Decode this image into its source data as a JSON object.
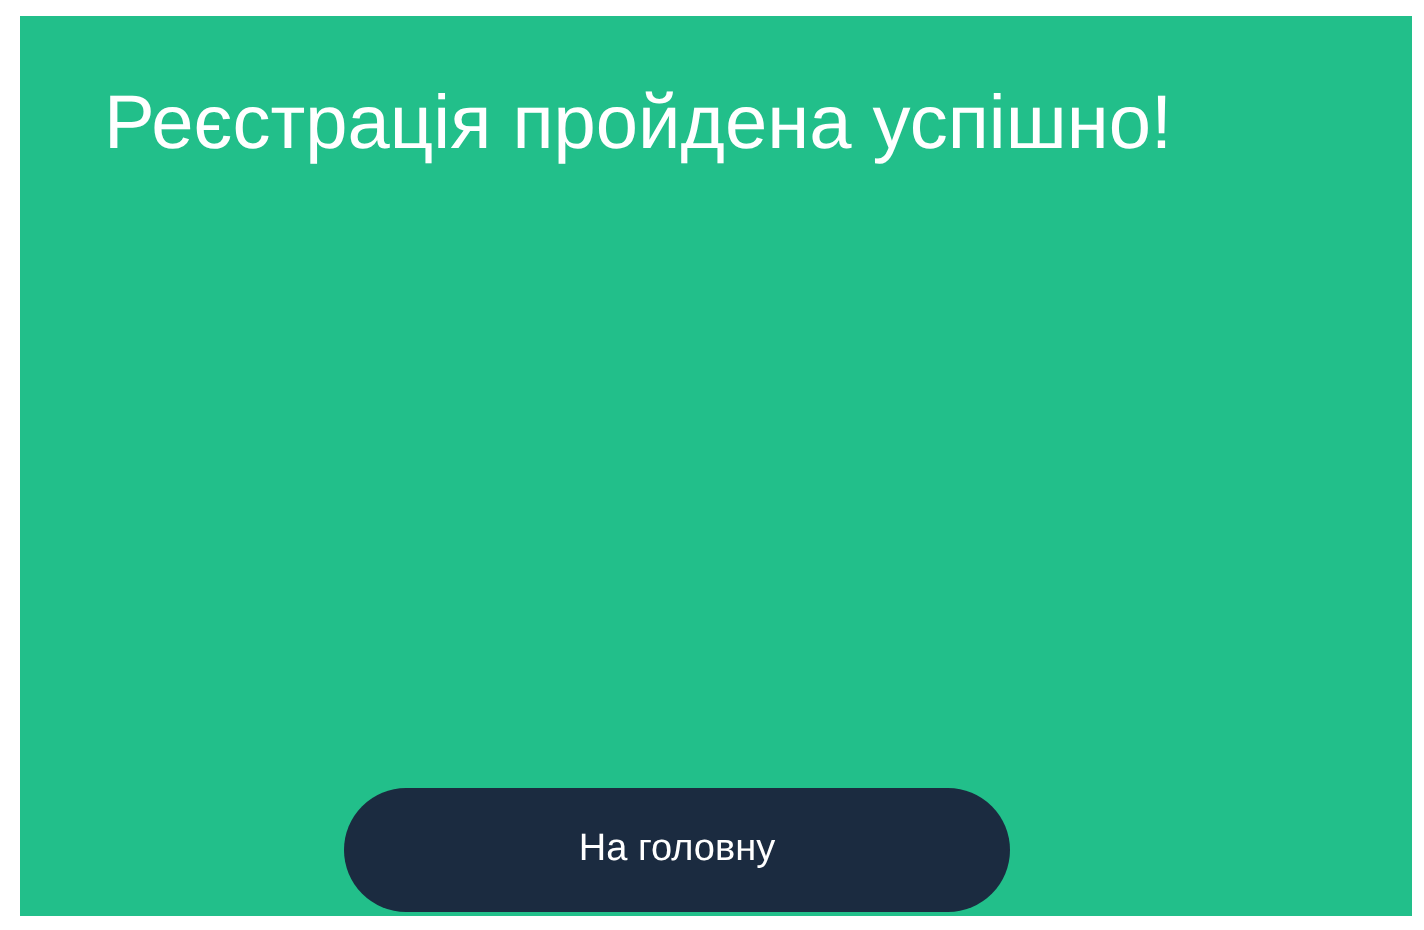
{
  "title": "Реєстрація пройдена успішно!",
  "button": {
    "label": "На головну"
  }
}
